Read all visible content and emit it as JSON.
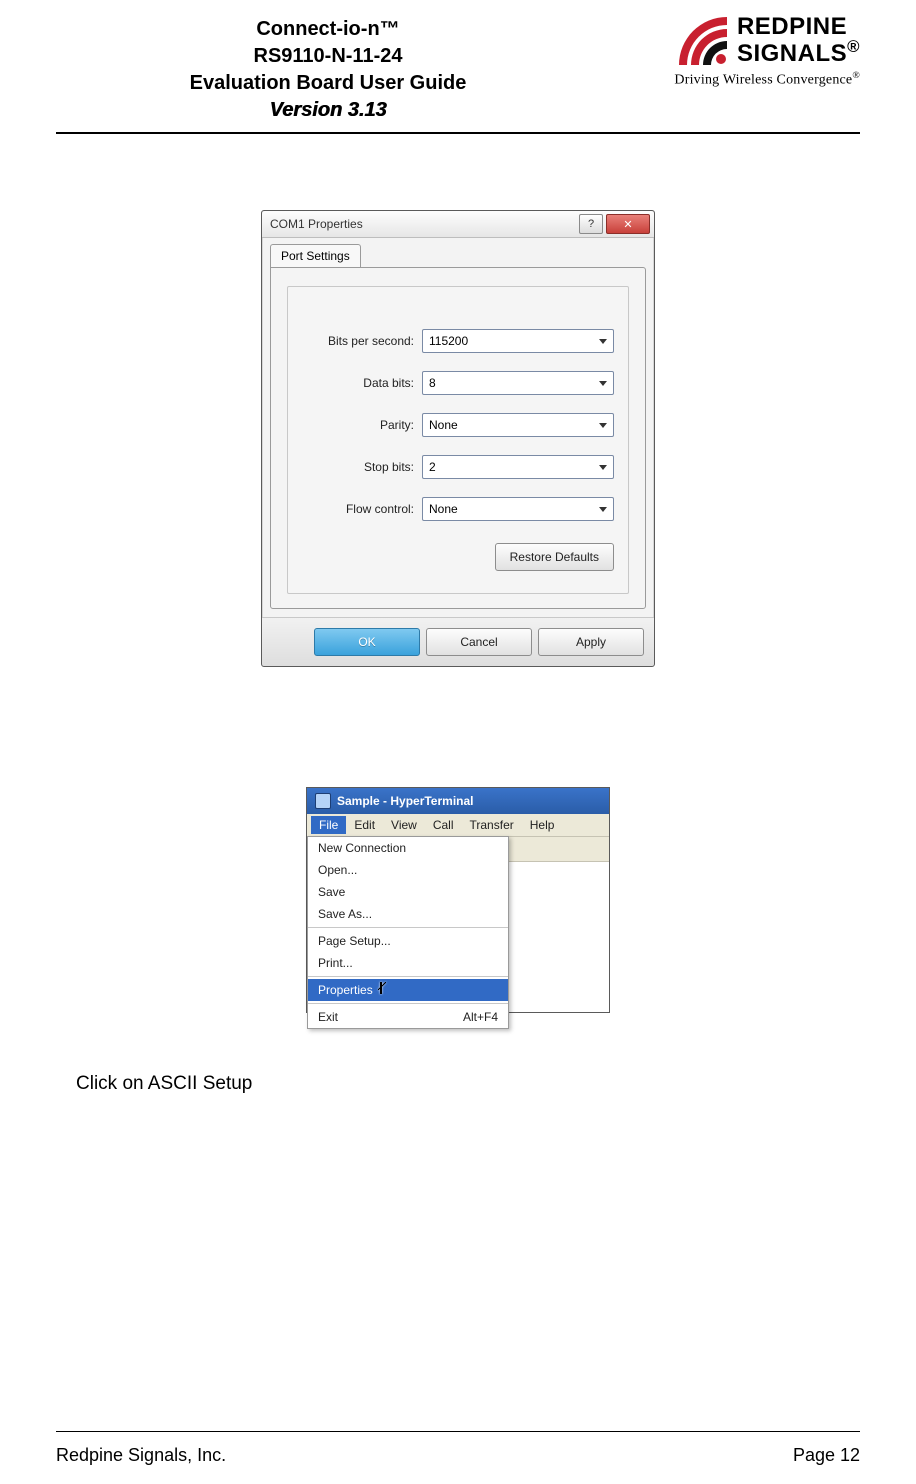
{
  "header": {
    "line1": "Connect-io-n™",
    "line2": "RS9110-N-11-24",
    "line3": "Evaluation Board User Guide",
    "version": "Version 3.13",
    "logo_line1": "REDPINE",
    "logo_line2": "SIGNALS",
    "reg": "®",
    "tagline_a": "Driving Wireless Convergence",
    "tagline_b": "®"
  },
  "shot1": {
    "title": "COM1 Properties",
    "help_glyph": "?",
    "close_glyph": "✕",
    "tab": "Port Settings",
    "fields": [
      {
        "label": "Bits per second:",
        "value": "115200"
      },
      {
        "label": "Data bits:",
        "value": "8"
      },
      {
        "label": "Parity:",
        "value": "None"
      },
      {
        "label": "Stop bits:",
        "value": "2"
      },
      {
        "label": "Flow control:",
        "value": "None"
      }
    ],
    "restore": "Restore Defaults",
    "ok": "OK",
    "cancel": "Cancel",
    "apply": "Apply"
  },
  "shot2": {
    "title": "Sample - HyperTerminal",
    "menus": [
      "File",
      "Edit",
      "View",
      "Call",
      "Transfer",
      "Help"
    ],
    "dropdown": {
      "g1": [
        "New Connection",
        "Open...",
        "Save",
        "Save As..."
      ],
      "g2": [
        "Page Setup...",
        "Print..."
      ],
      "properties": "Properties",
      "exit": "Exit",
      "exit_accel": "Alt+F4"
    }
  },
  "instruction": "Click on ASCII Setup",
  "footer": {
    "company": "Redpine Signals, Inc.",
    "page": "Page 12"
  }
}
